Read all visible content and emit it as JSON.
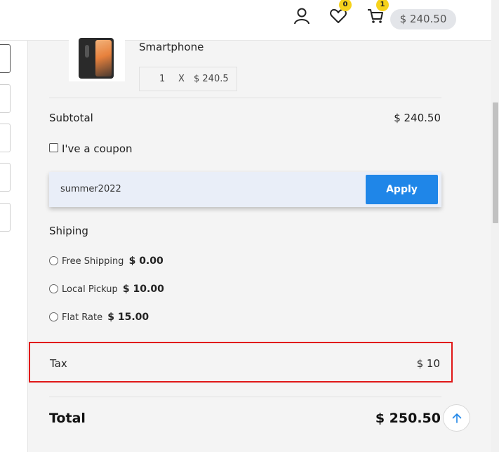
{
  "header": {
    "wishlist_count": "0",
    "cart_count": "1",
    "cart_total": "$ 240.50"
  },
  "cart_item": {
    "name": "Smartphone",
    "quantity": "1",
    "times": "X",
    "price": "$ 240.5"
  },
  "summary": {
    "subtotal_label": "Subtotal",
    "subtotal_value": "$ 240.50",
    "coupon_label": "I've a coupon",
    "coupon_code": "summer2022",
    "apply_label": "Apply",
    "shipping_title": "Shiping",
    "shipping_options": [
      {
        "label": "Free Shipping",
        "price": "$ 0.00"
      },
      {
        "label": "Local Pickup",
        "price": "$ 10.00"
      },
      {
        "label": "Flat Rate",
        "price": "$ 15.00"
      }
    ],
    "tax_label": "Tax",
    "tax_value": "$ 10",
    "total_label": "Total",
    "total_value": "$ 250.50"
  },
  "icons": {
    "account": "user-icon",
    "wishlist": "heart-icon",
    "cart": "cart-icon",
    "scroll_top": "arrow-up-icon"
  },
  "colors": {
    "accent": "#1f86e8",
    "badge": "#f6d21c",
    "highlight": "#e01818"
  }
}
